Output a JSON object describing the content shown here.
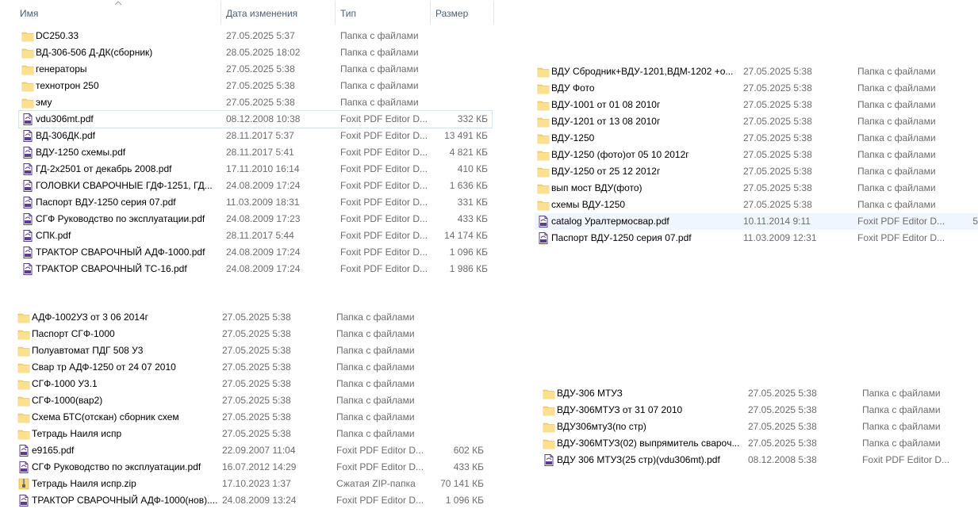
{
  "header": {
    "name": "Имя",
    "date": "Дата изменения",
    "type": "Тип",
    "size": "Размер"
  },
  "panel1": [
    {
      "name": "DC250.33",
      "date": "27.05.2025 5:37",
      "type": "Папка с файлами",
      "size": "",
      "icon": "folder"
    },
    {
      "name": "ВД-306-506 Д-ДК(сборник)",
      "date": "28.05.2025 18:02",
      "type": "Папка с файлами",
      "size": "",
      "icon": "folder"
    },
    {
      "name": "генераторы",
      "date": "27.05.2025 5:38",
      "type": "Папка с файлами",
      "size": "",
      "icon": "folder"
    },
    {
      "name": "технотрон 250",
      "date": "27.05.2025 5:38",
      "type": "Папка с файлами",
      "size": "",
      "icon": "folder"
    },
    {
      "name": "эму",
      "date": "27.05.2025 5:38",
      "type": "Папка с файлами",
      "size": "",
      "icon": "folder"
    },
    {
      "name": "vdu306mt.pdf",
      "date": "08.12.2008 10:38",
      "type": "Foxit PDF Editor D...",
      "size": "332 КБ",
      "icon": "pdf",
      "selected": true
    },
    {
      "name": "ВД-306ДК.pdf",
      "date": "28.11.2017 5:37",
      "type": "Foxit PDF Editor D...",
      "size": "13 491 КБ",
      "icon": "pdf"
    },
    {
      "name": "ВДУ-1250 схемы.pdf",
      "date": "28.11.2017 5:41",
      "type": "Foxit PDF Editor D...",
      "size": "4 821 КБ",
      "icon": "pdf"
    },
    {
      "name": "ГД-2х2501 от декабрь 2008.pdf",
      "date": "17.11.2010 16:14",
      "type": "Foxit PDF Editor D...",
      "size": "410 КБ",
      "icon": "pdf"
    },
    {
      "name": "ГОЛОВКИ СВАРОЧНЫЕ   ГДФ-1251, ГД...",
      "date": "24.08.2009 17:24",
      "type": "Foxit PDF Editor D...",
      "size": "1 636 КБ",
      "icon": "pdf"
    },
    {
      "name": "Паспорт ВДУ-1250 серия 07.pdf",
      "date": "11.03.2009 18:31",
      "type": "Foxit PDF Editor D...",
      "size": "331 КБ",
      "icon": "pdf"
    },
    {
      "name": "СГФ Руководство по эксплуатации.pdf",
      "date": "24.08.2009 17:23",
      "type": "Foxit PDF Editor D...",
      "size": "433 КБ",
      "icon": "pdf"
    },
    {
      "name": "СПК.pdf",
      "date": "28.11.2017 5:44",
      "type": "Foxit PDF Editor D...",
      "size": "14 174 КБ",
      "icon": "pdf"
    },
    {
      "name": "ТРАКТОР СВАРОЧНЫЙ АДФ-1000.pdf",
      "date": "24.08.2009 17:24",
      "type": "Foxit PDF Editor D...",
      "size": "1 096 КБ",
      "icon": "pdf"
    },
    {
      "name": "ТРАКТОР СВАРОЧНЫЙ ТС-16.pdf",
      "date": "24.08.2009 17:24",
      "type": "Foxit PDF Editor D...",
      "size": "1 986 КБ",
      "icon": "pdf"
    }
  ],
  "panel2": [
    {
      "name": "ВДУ Сбродник+ВДУ-1201,ВДМ-1202 +о...",
      "date": "27.05.2025 5:38",
      "type": "Папка с файлами",
      "size": "",
      "icon": "folder"
    },
    {
      "name": "ВДУ Фото",
      "date": "27.05.2025 5:38",
      "type": "Папка с файлами",
      "size": "",
      "icon": "folder"
    },
    {
      "name": "ВДУ-1001 от 01 08 2010г",
      "date": "27.05.2025 5:38",
      "type": "Папка с файлами",
      "size": "",
      "icon": "folder"
    },
    {
      "name": "ВДУ-1201 от 13 08 2010г",
      "date": "27.05.2025 5:38",
      "type": "Папка с файлами",
      "size": "",
      "icon": "folder"
    },
    {
      "name": "ВДУ-1250",
      "date": "27.05.2025 5:38",
      "type": "Папка с файлами",
      "size": "",
      "icon": "folder"
    },
    {
      "name": "ВДУ-1250 (фото)от 05 10 2012г",
      "date": "27.05.2025 5:38",
      "type": "Папка с файлами",
      "size": "",
      "icon": "folder"
    },
    {
      "name": "ВДУ-1250 от 25 12 2012г",
      "date": "27.05.2025 5:38",
      "type": "Папка с файлами",
      "size": "",
      "icon": "folder"
    },
    {
      "name": "вып мост ВДУ(фото)",
      "date": "27.05.2025 5:38",
      "type": "Папка с файлами",
      "size": "",
      "icon": "folder"
    },
    {
      "name": "схемы ВДУ-1250",
      "date": "27.05.2025 5:38",
      "type": "Папка с файлами",
      "size": "",
      "icon": "folder"
    },
    {
      "name": "catalog Уралтермосвар.pdf",
      "date": "10.11.2014 9:11",
      "type": "Foxit PDF Editor D...",
      "size": "5",
      "icon": "pdf",
      "highlighted": true
    },
    {
      "name": "Паспорт ВДУ-1250 серия 07.pdf",
      "date": "11.03.2009 12:31",
      "type": "Foxit PDF Editor D...",
      "size": "",
      "icon": "pdf"
    }
  ],
  "panel3": [
    {
      "name": "АДФ-1002УЗ от 3 06 2014г",
      "date": "27.05.2025 5:38",
      "type": "Папка с файлами",
      "size": "",
      "icon": "folder"
    },
    {
      "name": "Паспорт СГФ-1000",
      "date": "27.05.2025 5:38",
      "type": "Папка с файлами",
      "size": "",
      "icon": "folder"
    },
    {
      "name": "Полуавтомат ПДГ 508 У3",
      "date": "27.05.2025 5:38",
      "type": "Папка с файлами",
      "size": "",
      "icon": "folder"
    },
    {
      "name": "Свар тр АДФ-1250 от 24 07 2010",
      "date": "27.05.2025 5:38",
      "type": "Папка с файлами",
      "size": "",
      "icon": "folder"
    },
    {
      "name": "СГФ-1000 У3.1",
      "date": "27.05.2025 5:38",
      "type": "Папка с файлами",
      "size": "",
      "icon": "folder"
    },
    {
      "name": "СГФ-1000(вар2)",
      "date": "27.05.2025 5:38",
      "type": "Папка с файлами",
      "size": "",
      "icon": "folder"
    },
    {
      "name": "Схема БТС(отскан) сборник схем",
      "date": "27.05.2025 5:38",
      "type": "Папка с файлами",
      "size": "",
      "icon": "folder"
    },
    {
      "name": "Тетрадь Наиля испр",
      "date": "27.05.2025 5:38",
      "type": "Папка с файлами",
      "size": "",
      "icon": "folder"
    },
    {
      "name": "e9165.pdf",
      "date": "22.09.2007 11:04",
      "type": "Foxit PDF Editor D...",
      "size": "602 КБ",
      "icon": "pdf"
    },
    {
      "name": "СГФ Руководство по эксплуатации.pdf",
      "date": "16.07.2012 14:29",
      "type": "Foxit PDF Editor D...",
      "size": "433 КБ",
      "icon": "pdf"
    },
    {
      "name": "Тетрадь Наиля испр.zip",
      "date": "17.10.2023 1:37",
      "type": "Сжатая ZIP-папка",
      "size": "70 141 КБ",
      "icon": "zip"
    },
    {
      "name": "ТРАКТОР СВАРОЧНЫЙ АДФ-1000(нов)....",
      "date": "24.08.2009 13:24",
      "type": "Foxit PDF Editor D...",
      "size": "1 096 КБ",
      "icon": "pdf"
    }
  ],
  "panel4": [
    {
      "name": "ВДУ-306 МТУЗ",
      "date": "27.05.2025 5:38",
      "type": "Папка с файлами",
      "size": "",
      "icon": "folder"
    },
    {
      "name": "ВДУ-306МТУЗ от 31 07 2010",
      "date": "27.05.2025 5:38",
      "type": "Папка с файлами",
      "size": "",
      "icon": "folder"
    },
    {
      "name": "ВДУ306мту3(по стр)",
      "date": "27.05.2025 5:38",
      "type": "Папка с файлами",
      "size": "",
      "icon": "folder"
    },
    {
      "name": "ВДУ-306МТУЗ(02) выпрямитель сварoч...",
      "date": "27.05.2025 5:38",
      "type": "Папка с файлами",
      "size": "",
      "icon": "folder"
    },
    {
      "name": "ВДУ 306 МТУЗ(25 стр)(vdu306mt).pdf",
      "date": "08.12.2008 5:38",
      "type": "Foxit PDF Editor D...",
      "size": "",
      "icon": "pdf"
    }
  ],
  "colors": {
    "header_text": "#4c607a",
    "meta_text": "#6d6d6d",
    "folder": "#f8d775",
    "pdf": "#5a3d8c",
    "selection": "#cce8ff"
  }
}
